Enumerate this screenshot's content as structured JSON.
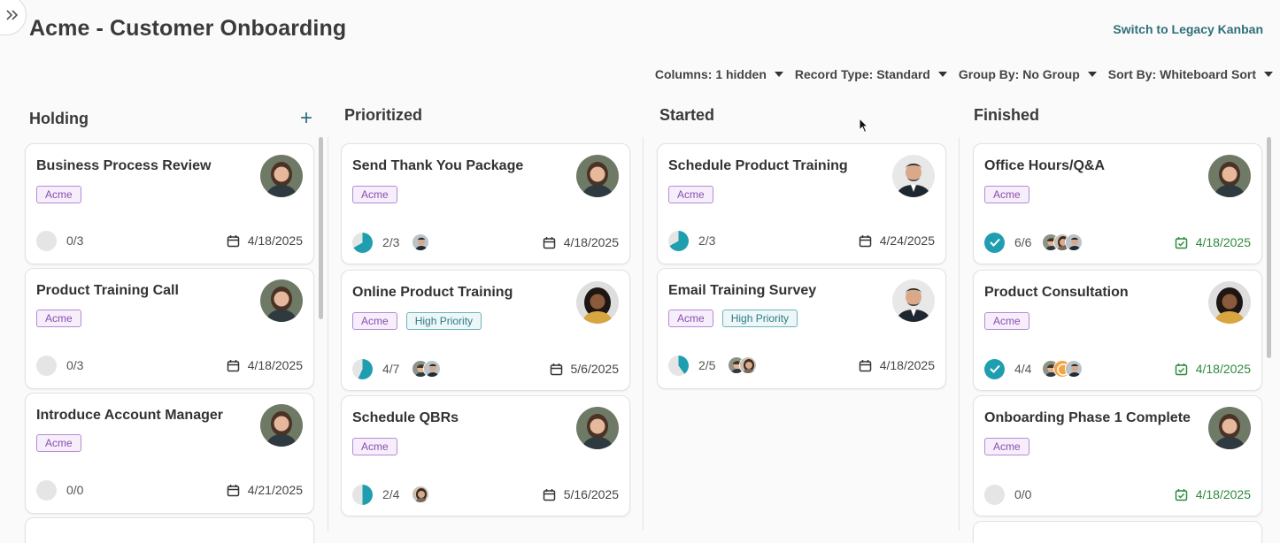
{
  "header": {
    "title": "Acme - Customer Onboarding",
    "legacy_link": "Switch to Legacy Kanban"
  },
  "filters": [
    {
      "label": "Columns: 1 hidden"
    },
    {
      "label": "Record Type: Standard"
    },
    {
      "label": "Group By: No Group"
    },
    {
      "label": "Sort By: Whiteboard Sort"
    }
  ],
  "columns": [
    {
      "title": "Holding",
      "cards": [
        {
          "title": "Business Process Review",
          "tags": [
            "Acme"
          ],
          "progress": "0/3",
          "due": "4/18/2025"
        },
        {
          "title": "Product Training Call",
          "tags": [
            "Acme"
          ],
          "progress": "0/3",
          "due": "4/18/2025"
        },
        {
          "title": "Introduce Account Manager",
          "tags": [
            "Acme"
          ],
          "progress": "0/0",
          "due": "4/21/2025"
        }
      ]
    },
    {
      "title": "Prioritized",
      "cards": [
        {
          "title": "Send Thank You Package",
          "tags": [
            "Acme"
          ],
          "progress": "2/3",
          "due": "4/18/2025"
        },
        {
          "title": "Online Product Training",
          "tags": [
            "Acme",
            "High Priority"
          ],
          "progress": "4/7",
          "due": "5/6/2025"
        },
        {
          "title": "Schedule QBRs",
          "tags": [
            "Acme"
          ],
          "progress": "2/4",
          "due": "5/16/2025"
        }
      ]
    },
    {
      "title": "Started",
      "cards": [
        {
          "title": "Schedule Product Training",
          "tags": [
            "Acme"
          ],
          "progress": "2/3",
          "due": "4/24/2025"
        },
        {
          "title": "Email Training Survey",
          "tags": [
            "Acme",
            "High Priority"
          ],
          "progress": "2/5",
          "due": "4/18/2025"
        }
      ]
    },
    {
      "title": "Finished",
      "cards": [
        {
          "title": "Office Hours/Q&A",
          "tags": [
            "Acme"
          ],
          "progress": "6/6",
          "due": "4/18/2025"
        },
        {
          "title": "Product Consultation",
          "tags": [
            "Acme"
          ],
          "progress": "4/4",
          "due": "4/18/2025"
        },
        {
          "title": "Onboarding Phase 1 Complete",
          "tags": [
            "Acme"
          ],
          "progress": "0/0",
          "due": "4/18/2025"
        }
      ]
    }
  ],
  "colors": {
    "accent_teal": "#1f9eb0",
    "link": "#2f6e78",
    "done_green": "#2e8a3d",
    "tag_acme": "#8a4fb0"
  }
}
